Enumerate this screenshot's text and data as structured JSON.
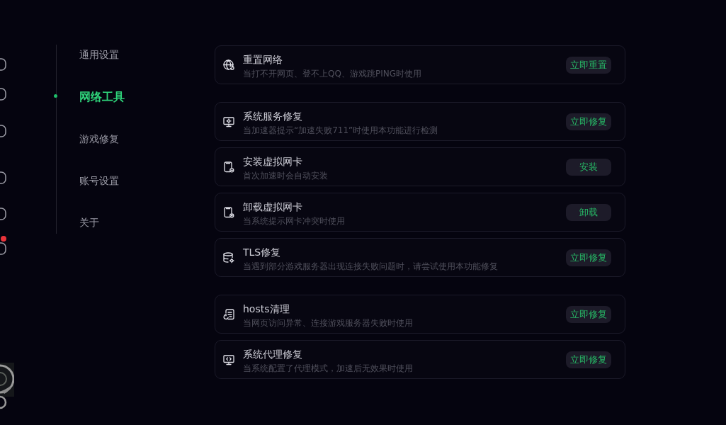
{
  "rail": {
    "items": [
      {
        "badge": false
      },
      {
        "badge": false
      },
      {
        "badge": false
      },
      {
        "badge": false
      },
      {
        "badge": false
      },
      {
        "badge": true
      }
    ]
  },
  "nav": {
    "items": [
      {
        "label": "通用设置",
        "selected": false
      },
      {
        "label": "网络工具",
        "selected": true
      },
      {
        "label": "游戏修复",
        "selected": false
      },
      {
        "label": "账号设置",
        "selected": false
      },
      {
        "label": "关于",
        "selected": false
      }
    ]
  },
  "groups": [
    {
      "items": [
        {
          "title": "重置网络",
          "description": "当打不开网页、登不上QQ、游戏跳PING时使用",
          "button": "立即重置"
        }
      ]
    },
    {
      "items": [
        {
          "title": "系统服务修复",
          "description": "当加速器提示“加速失败711”时使用本功能进行检测",
          "button": "立即修复"
        },
        {
          "title": "安装虚拟网卡",
          "description": "首次加速时会自动安装",
          "button": "安装"
        },
        {
          "title": "卸载虚拟网卡",
          "description": "当系统提示网卡冲突时使用",
          "button": "卸载"
        },
        {
          "title": "TLS修复",
          "description": "当遇到部分游戏服务器出现连接失败问题时，请尝试使用本功能修复",
          "button": "立即修复"
        }
      ]
    },
    {
      "items": [
        {
          "title": "hosts清理",
          "description": "当网页访问异常、连接游戏服务器失败时使用",
          "button": "立即修复"
        },
        {
          "title": "系统代理修复",
          "description": "当系统配置了代理模式，加速后无效果时使用",
          "button": "立即修复"
        }
      ]
    }
  ]
}
